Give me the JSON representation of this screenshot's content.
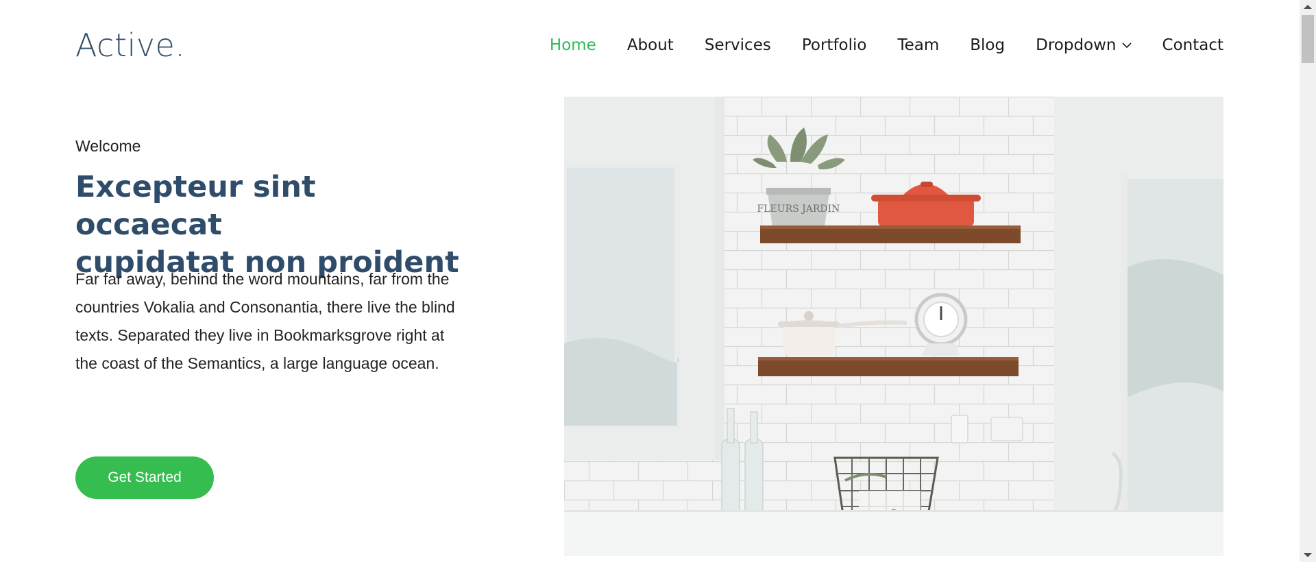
{
  "header": {
    "logo": "Active.",
    "nav": [
      {
        "label": "Home",
        "active": true
      },
      {
        "label": "About"
      },
      {
        "label": "Services"
      },
      {
        "label": "Portfolio"
      },
      {
        "label": "Team"
      },
      {
        "label": "Blog"
      },
      {
        "label": "Dropdown",
        "icon": "chevron-down-icon"
      },
      {
        "label": "Contact"
      }
    ]
  },
  "hero": {
    "welcome": "Welcome",
    "title_line1": "Excepteur sint occaecat",
    "title_line2": "cupidatat non proident",
    "description": "Far far away, behind the word mountains, far from the countries Vokalia and Consonantia, there live the blind texts. Separated they live in Bookmarksgrove right at the coast of the Semantics, a large language ocean.",
    "cta_label": "Get Started",
    "image_label": "FLEURS JARDIN"
  },
  "colors": {
    "brand": "#2f4d6a",
    "accent": "#36bd4f",
    "nav_active": "#2dba4e"
  }
}
